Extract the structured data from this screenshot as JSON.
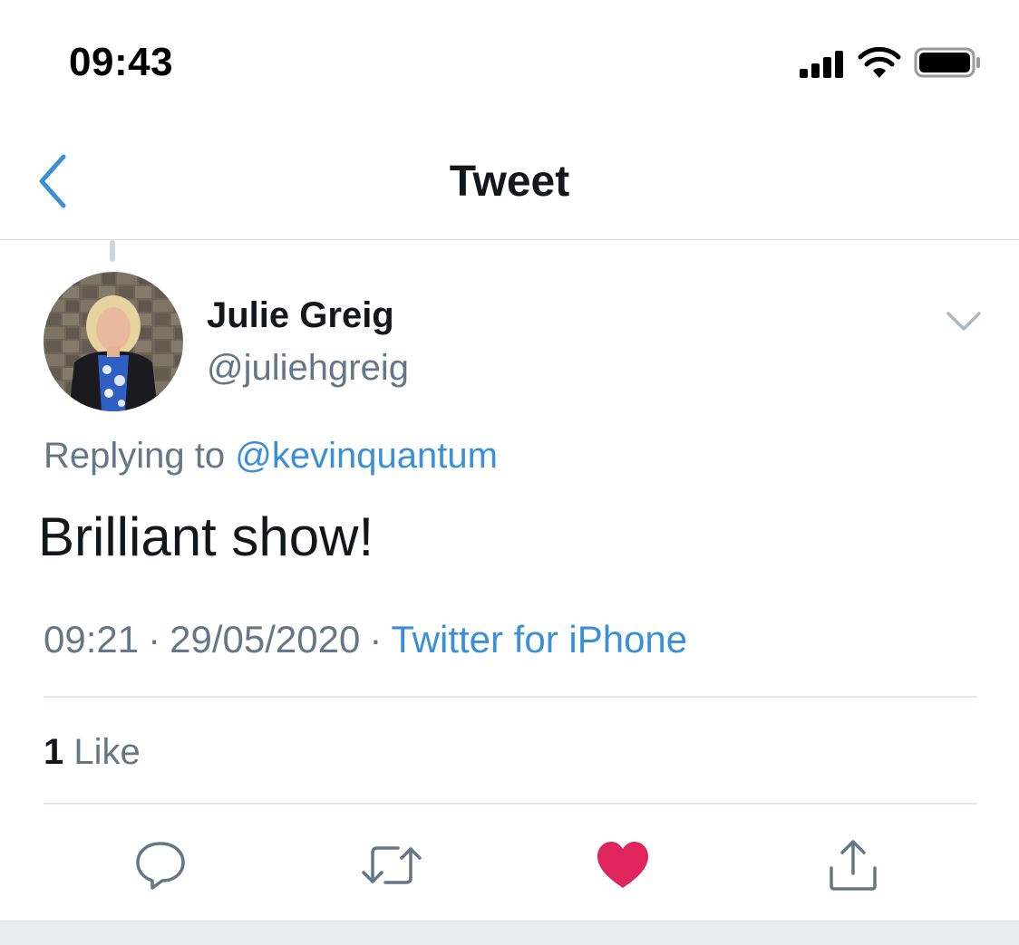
{
  "status_bar": {
    "time": "09:43",
    "icons": [
      "signal-icon",
      "wifi-icon",
      "battery-icon"
    ]
  },
  "nav": {
    "title": "Tweet",
    "back_icon": "chevron-left-icon"
  },
  "tweet": {
    "author": {
      "name": "Julie Greig",
      "handle": "@juliehgreig"
    },
    "reply": {
      "prefix": "Replying to",
      "target": "@kevinquantum"
    },
    "text": "Brilliant show!",
    "meta": {
      "time": "09:21",
      "separator": "·",
      "date": "29/05/2020",
      "source": "Twitter for iPhone"
    },
    "likes": {
      "count": "1",
      "label": "Like"
    },
    "liked": true,
    "actions": [
      "reply-icon",
      "retweet-icon",
      "like-icon",
      "share-icon"
    ]
  },
  "colors": {
    "link": "#3a8fd6",
    "secondary_text": "#657786",
    "primary_text": "#14171a",
    "like_active": "#e0245e",
    "action_icon": "#657786"
  }
}
